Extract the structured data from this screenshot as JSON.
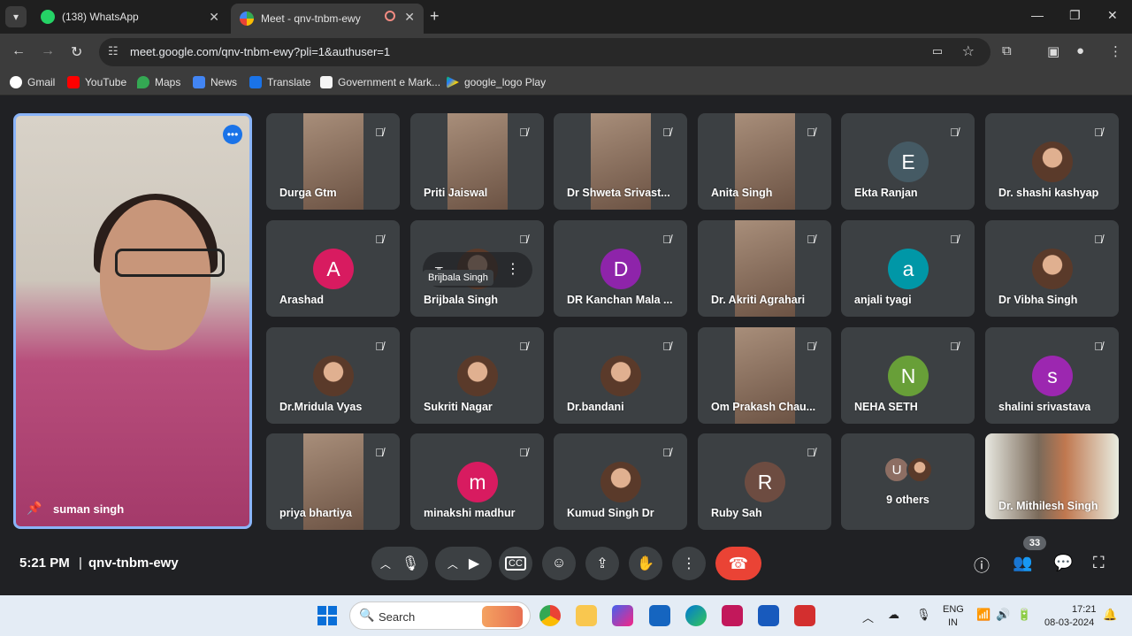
{
  "browser": {
    "tabs": [
      {
        "title": "(138) WhatsApp",
        "active": false
      },
      {
        "title": "Meet - qnv-tnbm-ewy",
        "active": true
      }
    ],
    "url": "meet.google.com/qnv-tnbm-ewy?pli=1&authuser=1",
    "bookmarks": [
      "Gmail",
      "YouTube",
      "Maps",
      "News",
      "Translate",
      "Government e Mark...",
      "google_logo Play"
    ]
  },
  "main_speaker": {
    "name": "suman singh"
  },
  "tiles": [
    {
      "name": "Durga Gtm",
      "kind": "video"
    },
    {
      "name": "Priti Jaiswal",
      "kind": "video"
    },
    {
      "name": "Dr Shweta Srivast...",
      "kind": "video"
    },
    {
      "name": "Anita Singh",
      "kind": "video"
    },
    {
      "name": "Ekta Ranjan",
      "kind": "letter",
      "letter": "E",
      "color": "#455a64"
    },
    {
      "name": "Dr. shashi kashyap",
      "kind": "photo"
    },
    {
      "name": "Arashad",
      "kind": "letter",
      "letter": "A",
      "color": "#d81b60"
    },
    {
      "name": "Brijbala Singh",
      "kind": "hover",
      "tooltip": "Brijbala Singh"
    },
    {
      "name": "DR Kanchan Mala ...",
      "kind": "letter",
      "letter": "D",
      "color": "#8e24aa"
    },
    {
      "name": "Dr. Akriti Agrahari",
      "kind": "video"
    },
    {
      "name": "anjali tyagi",
      "kind": "letter",
      "letter": "a",
      "color": "#0097a7"
    },
    {
      "name": "Dr Vibha Singh",
      "kind": "photo"
    },
    {
      "name": "Dr.Mridula Vyas",
      "kind": "photo"
    },
    {
      "name": "Sukriti Nagar",
      "kind": "photo"
    },
    {
      "name": "Dr.bandani",
      "kind": "photo"
    },
    {
      "name": "Om Prakash Chau...",
      "kind": "video"
    },
    {
      "name": "NEHA SETH",
      "kind": "letter",
      "letter": "N",
      "color": "#689f38"
    },
    {
      "name": "shalini srivastava",
      "kind": "letter",
      "letter": "s",
      "color": "#9c27b0"
    },
    {
      "name": "priya bhartiya",
      "kind": "video"
    },
    {
      "name": "minakshi madhur",
      "kind": "letter",
      "letter": "m",
      "color": "#d81b60"
    },
    {
      "name": "Kumud Singh Dr",
      "kind": "photo"
    },
    {
      "name": "Ruby Sah",
      "kind": "letter",
      "letter": "R",
      "color": "#6d4c41"
    },
    {
      "name": "9 others",
      "kind": "others",
      "letter": "U"
    },
    {
      "name": "Dr. Mithilesh Singh",
      "kind": "wide"
    }
  ],
  "controls": {
    "time": "5:21 PM",
    "meeting_code": "qnv-tnbm-ewy",
    "participants_count": "33"
  },
  "taskbar": {
    "search_label": "Search",
    "lang_top": "ENG",
    "lang_bottom": "IN",
    "clock_time": "17:21",
    "clock_date": "08-03-2024"
  }
}
